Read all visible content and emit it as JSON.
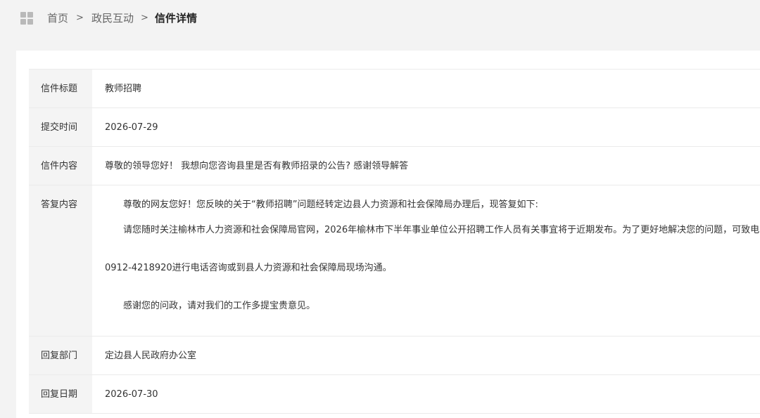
{
  "breadcrumb": {
    "home": "首页",
    "section": "政民互动",
    "current": "信件详情",
    "separator": ">"
  },
  "icons": {
    "breadcrumb_icon": "grid-icon"
  },
  "colors": {
    "page_background": "#f3f3f3",
    "label_background": "#f4f4f4",
    "border": "#ebebeb"
  },
  "letter": {
    "title_label": "信件标题",
    "title": "教师招聘",
    "submit_time_label": "提交时间",
    "submit_time": "2026-07-29",
    "content_label": "信件内容",
    "content": "尊敬的领导您好！ 我想向您咨询县里是否有教师招录的公告? 感谢领导解答",
    "reply_label": "答复内容",
    "reply_paragraphs": [
      "尊敬的网友您好！您反映的关于“教师招聘”问题经转定边县人力资源和社会保障局办理后，现答复如下:",
      "请您随时关注榆林市人力资源和社会保障局官网，2026年榆林市下半年事业单位公开招聘工作人员有关事宜将于近期发布。为了更好地解决您的问题，可致电",
      "0912-4218920进行电话咨询或到县人力资源和社会保障局现场沟通。",
      "感谢您的问政，请对我们的工作多提宝贵意见。"
    ],
    "reply_dept_label": "回复部门",
    "reply_dept": "定边县人民政府办公室",
    "reply_date_label": "回复日期",
    "reply_date": "2026-07-30"
  }
}
